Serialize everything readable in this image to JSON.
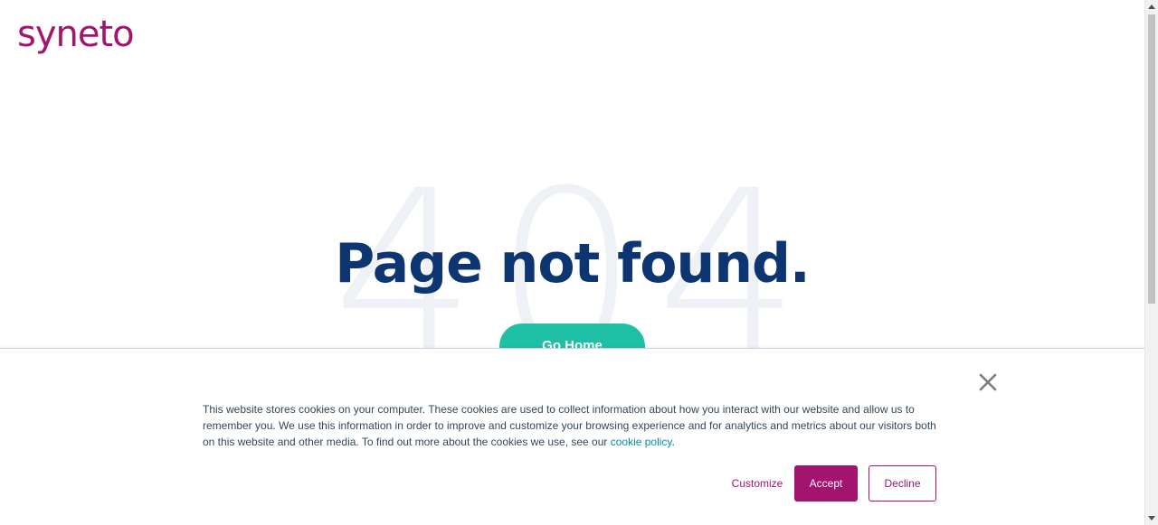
{
  "header": {
    "logo_text": "syneto"
  },
  "main": {
    "background_number": "404",
    "title": "Page not found.",
    "go_home_label": "Go Home"
  },
  "cookie_banner": {
    "text_before_link": "This website stores cookies on your computer. These cookies are used to collect information about how you interact with our website and allow us to remember you. We use this information in order to improve and customize your browsing experience and for analytics and metrics about our visitors both on this website and other media. To find out more about the cookies we use, see our ",
    "link_text": "cookie policy",
    "text_after_link": ".",
    "close_icon": "close-icon",
    "customize_label": "Customize",
    "accept_label": "Accept",
    "decline_label": "Decline"
  },
  "colors": {
    "brand": "#a3146f",
    "title": "#0d3572",
    "go_home": "#1fc0a6",
    "link": "#0091ae"
  }
}
